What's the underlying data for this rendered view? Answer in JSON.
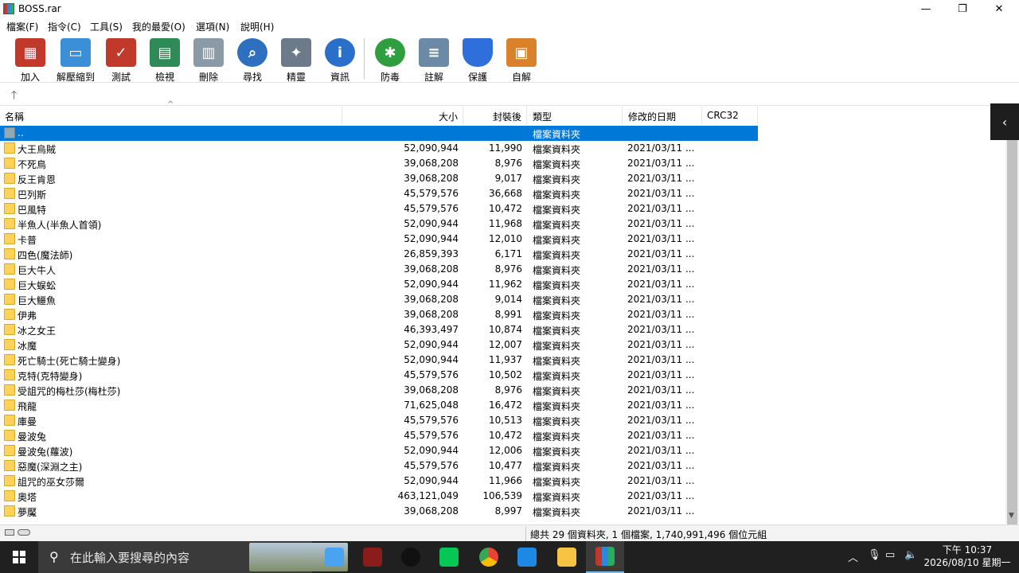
{
  "window": {
    "title": "BOSS.rar",
    "min": "—",
    "max": "❐",
    "close": "✕"
  },
  "menu": [
    "檔案(F)",
    "指令(C)",
    "工具(S)",
    "我的最愛(O)",
    "選項(N)",
    "說明(H)"
  ],
  "toolbar": [
    {
      "label": "加入",
      "icon": "add-archive-icon",
      "color": "#c0392b"
    },
    {
      "label": "解壓縮到",
      "icon": "extract-folder-icon",
      "color": "#3b8ed8"
    },
    {
      "label": "測試",
      "icon": "test-clipboard-icon",
      "color": "#c0392b"
    },
    {
      "label": "檢視",
      "icon": "view-book-icon",
      "color": "#2e8b57"
    },
    {
      "label": "刪除",
      "icon": "trash-icon",
      "color": "#8a9aa6"
    },
    {
      "label": "尋找",
      "icon": "magnifier-icon",
      "color": "#2f6fbf"
    },
    {
      "label": "精靈",
      "icon": "wizard-wand-icon",
      "color": "#6c7a89"
    },
    {
      "label": "資訊",
      "icon": "info-icon",
      "color": "#2a6fc9"
    },
    {
      "label": "防毒",
      "icon": "antivirus-bug-icon",
      "color": "#2e9e3e"
    },
    {
      "label": "註解",
      "icon": "comment-icon",
      "color": "#6c8aa6"
    },
    {
      "label": "保護",
      "icon": "shield-icon",
      "color": "#2f6fdc"
    },
    {
      "label": "自解",
      "icon": "sfx-box-icon",
      "color": "#d9822b"
    }
  ],
  "columns": {
    "name": "名稱",
    "size": "大小",
    "packed": "封裝後",
    "type": "類型",
    "modified": "修改的日期",
    "crc": "CRC32"
  },
  "parent_row": {
    "name": "..",
    "type": "檔案資料夾"
  },
  "rows": [
    {
      "name": "大王烏賊",
      "size": "52,090,944",
      "packed": "11,990",
      "type": "檔案資料夾",
      "date": "2021/03/11 ..."
    },
    {
      "name": "不死鳥",
      "size": "39,068,208",
      "packed": "8,976",
      "type": "檔案資料夾",
      "date": "2021/03/11 ..."
    },
    {
      "name": "反王肯恩",
      "size": "39,068,208",
      "packed": "9,017",
      "type": "檔案資料夾",
      "date": "2021/03/11 ..."
    },
    {
      "name": "巴列斯",
      "size": "45,579,576",
      "packed": "36,668",
      "type": "檔案資料夾",
      "date": "2021/03/11 ..."
    },
    {
      "name": "巴風特",
      "size": "45,579,576",
      "packed": "10,472",
      "type": "檔案資料夾",
      "date": "2021/03/11 ..."
    },
    {
      "name": "半魚人(半魚人首領)",
      "size": "52,090,944",
      "packed": "11,968",
      "type": "檔案資料夾",
      "date": "2021/03/11 ..."
    },
    {
      "name": "卡普",
      "size": "52,090,944",
      "packed": "12,010",
      "type": "檔案資料夾",
      "date": "2021/03/11 ..."
    },
    {
      "name": "四色(魔法師)",
      "size": "26,859,393",
      "packed": "6,171",
      "type": "檔案資料夾",
      "date": "2021/03/11 ..."
    },
    {
      "name": "巨大牛人",
      "size": "39,068,208",
      "packed": "8,976",
      "type": "檔案資料夾",
      "date": "2021/03/11 ..."
    },
    {
      "name": "巨大蜈蚣",
      "size": "52,090,944",
      "packed": "11,962",
      "type": "檔案資料夾",
      "date": "2021/03/11 ..."
    },
    {
      "name": "巨大鱷魚",
      "size": "39,068,208",
      "packed": "9,014",
      "type": "檔案資料夾",
      "date": "2021/03/11 ..."
    },
    {
      "name": "伊弗",
      "size": "39,068,208",
      "packed": "8,991",
      "type": "檔案資料夾",
      "date": "2021/03/11 ..."
    },
    {
      "name": "冰之女王",
      "size": "46,393,497",
      "packed": "10,874",
      "type": "檔案資料夾",
      "date": "2021/03/11 ..."
    },
    {
      "name": "冰魔",
      "size": "52,090,944",
      "packed": "12,007",
      "type": "檔案資料夾",
      "date": "2021/03/11 ..."
    },
    {
      "name": "死亡騎士(死亡騎士變身)",
      "size": "52,090,944",
      "packed": "11,937",
      "type": "檔案資料夾",
      "date": "2021/03/11 ..."
    },
    {
      "name": "克特(克特變身)",
      "size": "45,579,576",
      "packed": "10,502",
      "type": "檔案資料夾",
      "date": "2021/03/11 ..."
    },
    {
      "name": "受詛咒的梅杜莎(梅杜莎)",
      "size": "39,068,208",
      "packed": "8,976",
      "type": "檔案資料夾",
      "date": "2021/03/11 ..."
    },
    {
      "name": "飛龍",
      "size": "71,625,048",
      "packed": "16,472",
      "type": "檔案資料夾",
      "date": "2021/03/11 ..."
    },
    {
      "name": "庫曼",
      "size": "45,579,576",
      "packed": "10,513",
      "type": "檔案資料夾",
      "date": "2021/03/11 ..."
    },
    {
      "name": "曼波兔",
      "size": "45,579,576",
      "packed": "10,472",
      "type": "檔案資料夾",
      "date": "2021/03/11 ..."
    },
    {
      "name": "曼波兔(蘿波)",
      "size": "52,090,944",
      "packed": "12,006",
      "type": "檔案資料夾",
      "date": "2021/03/11 ..."
    },
    {
      "name": "惡魔(深淵之主)",
      "size": "45,579,576",
      "packed": "10,477",
      "type": "檔案資料夾",
      "date": "2021/03/11 ..."
    },
    {
      "name": "詛咒的巫女莎爾",
      "size": "52,090,944",
      "packed": "11,966",
      "type": "檔案資料夾",
      "date": "2021/03/11 ..."
    },
    {
      "name": "奧塔",
      "size": "463,121,049",
      "packed": "106,539",
      "type": "檔案資料夾",
      "date": "2021/03/11 ..."
    },
    {
      "name": "夢魘",
      "size": "39,068,208",
      "packed": "8,997",
      "type": "檔案資料夾",
      "date": "2021/03/11 ..."
    }
  ],
  "status": "總共 29 個資料夾, 1 個檔案, 1,740,991,496 個位元組",
  "taskbar": {
    "search_placeholder": "在此輸入要搜尋的內容",
    "time": "下午 10:37",
    "date": "2026/08/10 星期一"
  }
}
